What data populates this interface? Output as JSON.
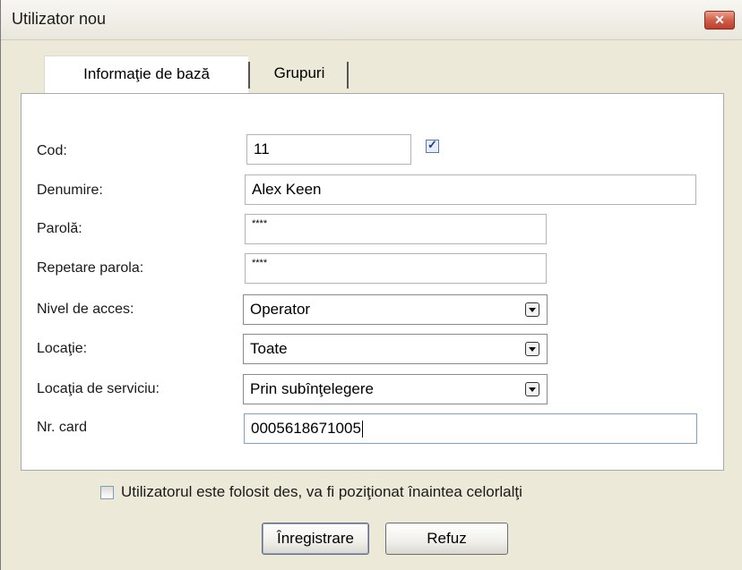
{
  "window": {
    "title": "Utilizator nou",
    "close_label": "✕"
  },
  "tabs": [
    {
      "label": "Informaţie de bază",
      "active": true
    },
    {
      "label": "Grupuri",
      "active": false
    }
  ],
  "form": {
    "cod": {
      "label": "Cod:",
      "value": "11",
      "checked": true
    },
    "denumire": {
      "label": "Denumire:",
      "value": "Alex Keen"
    },
    "parola": {
      "label": "Parolă:",
      "value": "****"
    },
    "repetare_parola": {
      "label": "Repetare parola:",
      "value": "****"
    },
    "nivel_acces": {
      "label": "Nivel de acces:",
      "value": "Operator"
    },
    "locatie": {
      "label": "Locaţie:",
      "value": "Toate"
    },
    "locatia_serviciu": {
      "label": "Locaţia de serviciu:",
      "value": "Prin subînţelegere"
    },
    "nr_card": {
      "label": "Nr. card",
      "value": "0005618671005"
    }
  },
  "frequent_user": {
    "label": "Utilizatorul este folosit des, va fi poziţionat înaintea celorlalţi",
    "checked": false
  },
  "buttons": {
    "save_label": "Înregistrare",
    "cancel_label": "Refuz"
  }
}
